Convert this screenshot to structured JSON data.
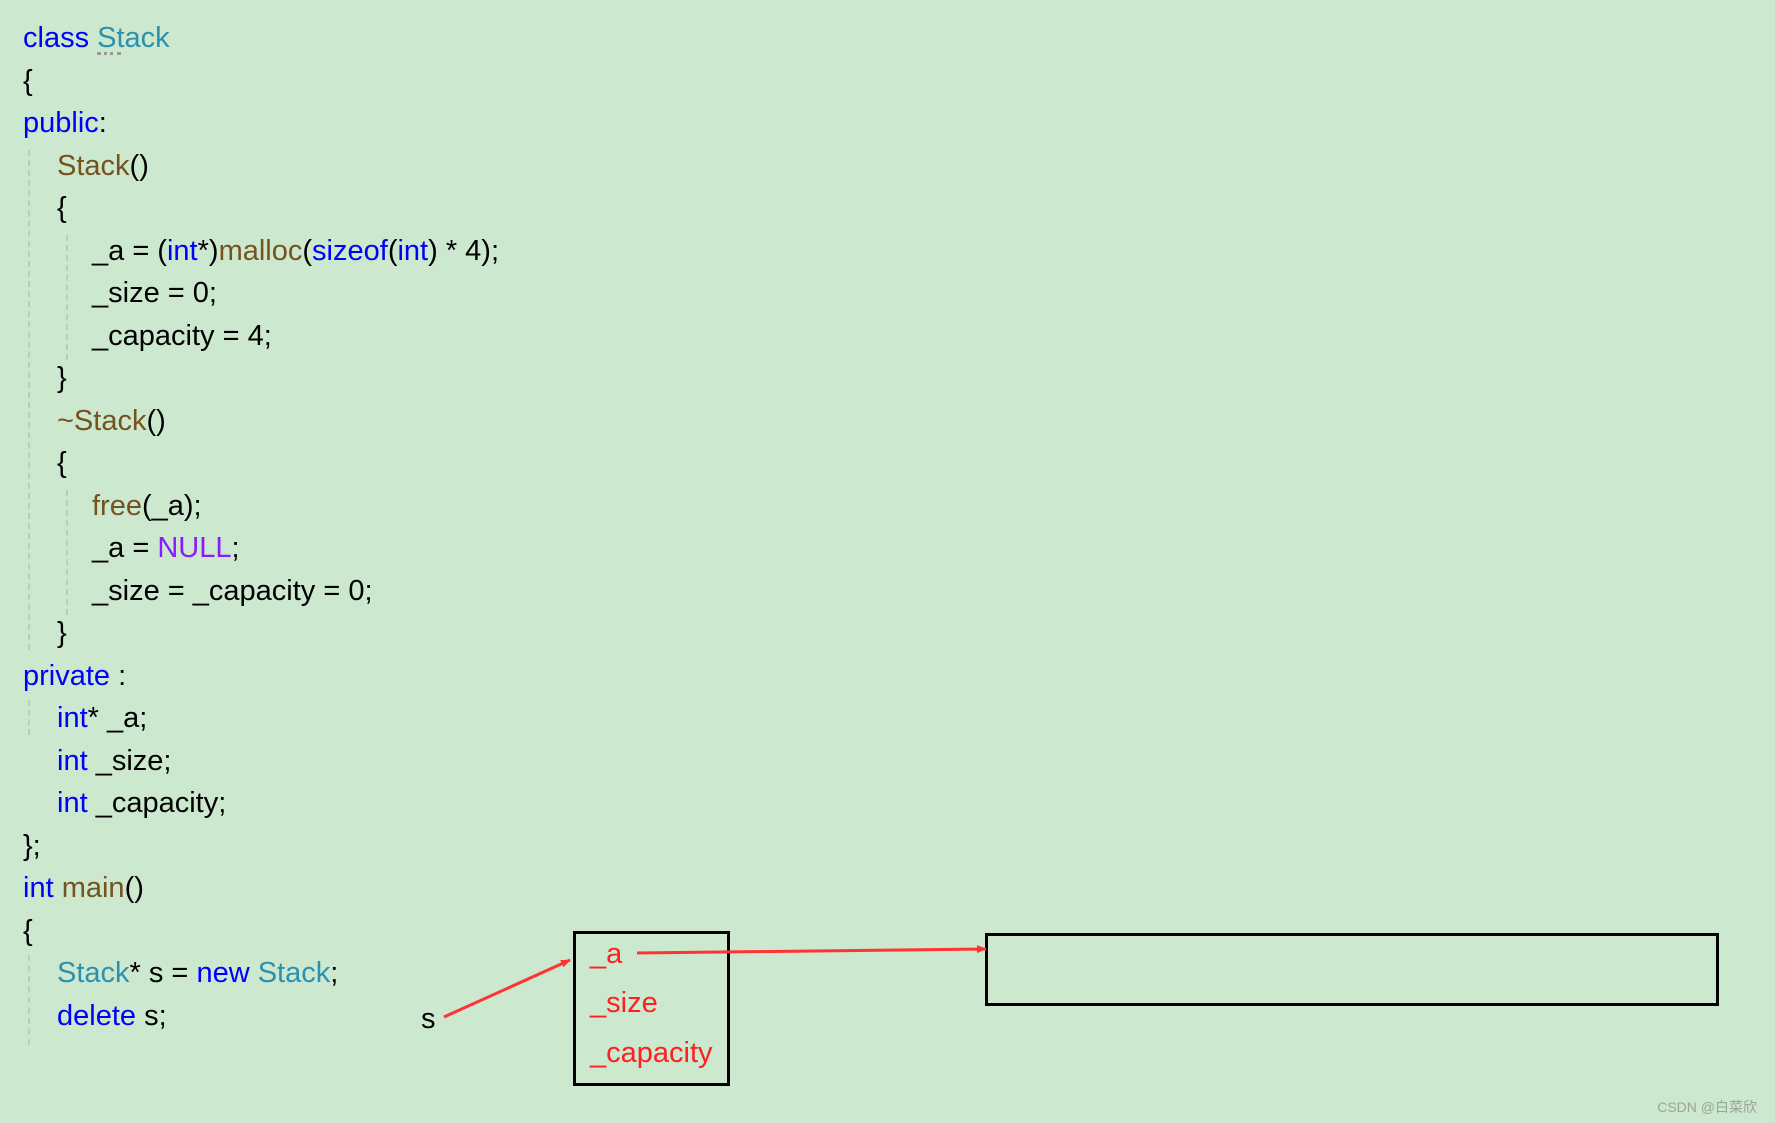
{
  "code": [
    {
      "indent": 0,
      "tokens": [
        [
          "class",
          "kw"
        ],
        [
          " ",
          "pl"
        ],
        [
          "Stack",
          "ty"
        ]
      ]
    },
    {
      "indent": 0,
      "tokens": [
        [
          "{",
          "pl"
        ]
      ]
    },
    {
      "indent": 0,
      "tokens": [
        [
          "public",
          "kw"
        ],
        [
          ":",
          "pl"
        ]
      ]
    },
    {
      "indent": 1,
      "tokens": [
        [
          "Stack",
          "fn"
        ],
        [
          "()",
          "pl"
        ]
      ]
    },
    {
      "indent": 1,
      "tokens": [
        [
          "{",
          "pl"
        ]
      ]
    },
    {
      "indent": 2,
      "tokens": [
        [
          "_a = (",
          "pl"
        ],
        [
          "int",
          "kw"
        ],
        [
          "*)",
          "pl"
        ],
        [
          "malloc",
          "fn"
        ],
        [
          "(",
          "pl"
        ],
        [
          "sizeof",
          "kw"
        ],
        [
          "(",
          "pl"
        ],
        [
          "int",
          "kw"
        ],
        [
          ") * 4);",
          "pl"
        ]
      ]
    },
    {
      "indent": 2,
      "tokens": [
        [
          "_size = 0;",
          "pl"
        ]
      ]
    },
    {
      "indent": 2,
      "tokens": [
        [
          "_capacity = 4;",
          "pl"
        ]
      ]
    },
    {
      "indent": 1,
      "tokens": [
        [
          "}",
          "pl"
        ]
      ]
    },
    {
      "indent": 1,
      "tokens": [
        [
          "~Stack",
          "fn"
        ],
        [
          "()",
          "pl"
        ]
      ]
    },
    {
      "indent": 1,
      "tokens": [
        [
          "{",
          "pl"
        ]
      ]
    },
    {
      "indent": 2,
      "tokens": [
        [
          "free",
          "fn"
        ],
        [
          "(_a);",
          "pl"
        ]
      ]
    },
    {
      "indent": 2,
      "tokens": [
        [
          "_a = ",
          "pl"
        ],
        [
          "NULL",
          "mac"
        ],
        [
          ";",
          "pl"
        ]
      ]
    },
    {
      "indent": 2,
      "tokens": [
        [
          "_size = _capacity = 0;",
          "pl"
        ]
      ]
    },
    {
      "indent": 1,
      "tokens": [
        [
          "}",
          "pl"
        ]
      ]
    },
    {
      "indent": 0,
      "tokens": [
        [
          "private",
          "kw"
        ],
        [
          " :",
          "pl"
        ]
      ]
    },
    {
      "indent": 1,
      "tokens": [
        [
          "int",
          "kw"
        ],
        [
          "* _a;",
          "pl"
        ]
      ]
    },
    {
      "indent": 1,
      "tokens": [
        [
          "int",
          "kw"
        ],
        [
          " _size;",
          "pl"
        ]
      ]
    },
    {
      "indent": 1,
      "tokens": [
        [
          "int",
          "kw"
        ],
        [
          " _capacity;",
          "pl"
        ]
      ]
    },
    {
      "indent": 0,
      "tokens": [
        [
          "};",
          "pl"
        ]
      ]
    },
    {
      "indent": 0,
      "tokens": [
        [
          "int",
          "kw"
        ],
        [
          " ",
          "pl"
        ],
        [
          "main",
          "fn"
        ],
        [
          "()",
          "pl"
        ]
      ]
    },
    {
      "indent": 0,
      "tokens": [
        [
          "{",
          "pl"
        ]
      ]
    },
    {
      "indent": 1,
      "tokens": [
        [
          "Stack",
          "ty"
        ],
        [
          "* s = ",
          "pl"
        ],
        [
          "new",
          "kw"
        ],
        [
          " ",
          "pl"
        ],
        [
          "Stack",
          "ty"
        ],
        [
          ";",
          "pl"
        ]
      ]
    },
    {
      "indent": 1,
      "tokens": [
        [
          "delete",
          "kw"
        ],
        [
          " s;",
          "pl"
        ]
      ]
    }
  ],
  "diagram": {
    "pointer_label": "s",
    "object_fields": [
      "_a",
      "_size",
      "_capacity"
    ],
    "arrow_color": "#ff3333"
  },
  "colors": {
    "background": "#cce8cf",
    "keyword": "#0000ff",
    "type": "#2b91af",
    "function": "#74531f",
    "macro": "#8a1bff",
    "annotation": "#ff2020"
  },
  "watermark": "CSDN @白菜欣"
}
